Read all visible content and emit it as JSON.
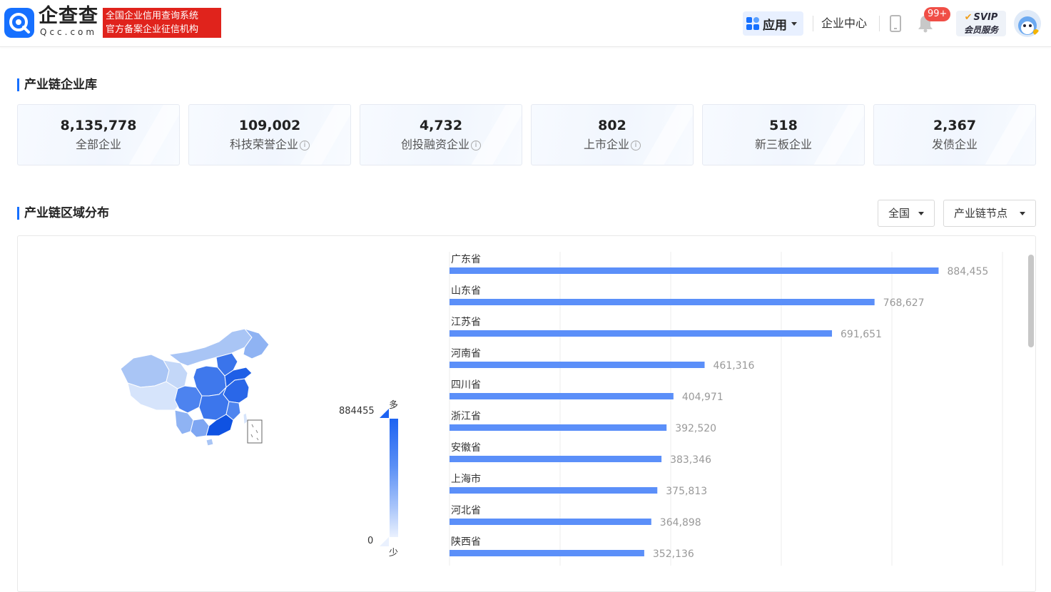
{
  "header": {
    "logo_name": "企查查",
    "logo_domain": "Qcc.com",
    "slogan_line1": "全国企业信用查询系统",
    "slogan_line2": "官方备案企业征信机构",
    "app_label": "应用",
    "enterprise_center": "企业中心",
    "notification_badge": "99+",
    "svip_line1": "SVIP",
    "svip_line2": "会员服务"
  },
  "section1": {
    "title": "产业链企业库",
    "cards": [
      {
        "value": "8,135,778",
        "label": "全部企业",
        "info": false
      },
      {
        "value": "109,002",
        "label": "科技荣誉企业",
        "info": true
      },
      {
        "value": "4,732",
        "label": "创投融资企业",
        "info": true
      },
      {
        "value": "802",
        "label": "上市企业",
        "info": true
      },
      {
        "value": "518",
        "label": "新三板企业",
        "info": false
      },
      {
        "value": "2,367",
        "label": "发债企业",
        "info": false
      }
    ]
  },
  "section2": {
    "title": "产业链区域分布",
    "filter_region": "全国",
    "filter_node": "产业链节点"
  },
  "map_legend": {
    "max": "884455",
    "min": "0",
    "high_label": "多",
    "low_label": "少"
  },
  "colors": {
    "accent": "#1670ff",
    "bar": "#5b8ff9",
    "brand_red": "#e0231c"
  },
  "chart_data": {
    "type": "bar",
    "orientation": "horizontal",
    "categories": [
      "广东省",
      "山东省",
      "江苏省",
      "河南省",
      "四川省",
      "浙江省",
      "安徽省",
      "上海市",
      "河北省",
      "陕西省"
    ],
    "values": [
      884455,
      768627,
      691651,
      461316,
      404971,
      392520,
      383346,
      375813,
      364898,
      352136
    ],
    "value_labels": [
      "884,455",
      "768,627",
      "691,651",
      "461,316",
      "404,971",
      "392,520",
      "383,346",
      "375,813",
      "364,898",
      "352,136"
    ],
    "xlim": [
      0,
      1000000
    ],
    "grid": true
  }
}
